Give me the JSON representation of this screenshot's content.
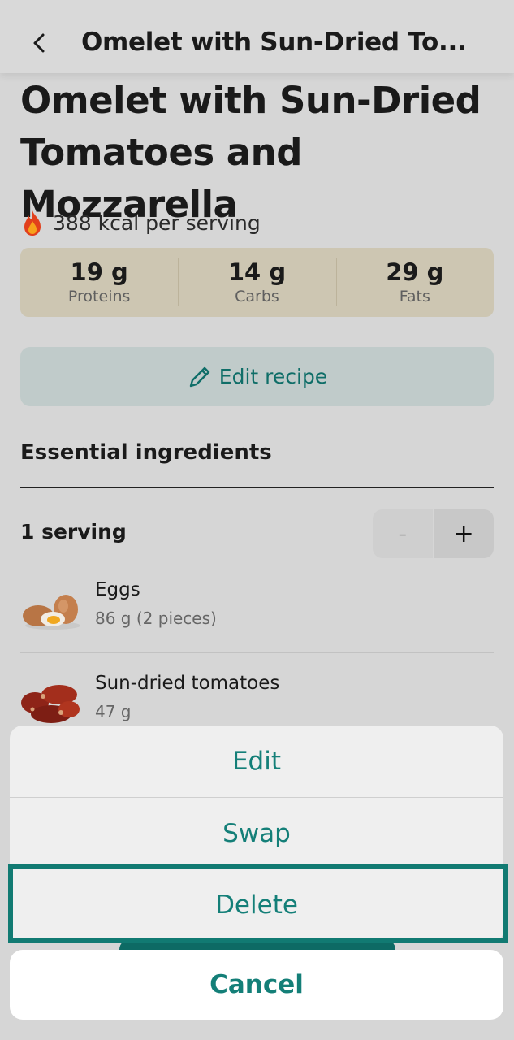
{
  "header": {
    "title": "Omelet with Sun-Dried To..."
  },
  "recipe": {
    "title": "Omelet with Sun-Dried Tomatoes and Mozzarella",
    "kcal": "388 kcal per serving",
    "macros": [
      {
        "value": "19 g",
        "label": "Proteins"
      },
      {
        "value": "14 g",
        "label": "Carbs"
      },
      {
        "value": "29 g",
        "label": "Fats"
      }
    ],
    "edit_label": "Edit recipe"
  },
  "ingredients": {
    "section_title": "Essential ingredients",
    "serving_label": "1 serving",
    "minus": "-",
    "plus": "+",
    "items": [
      {
        "name": "Eggs",
        "amount": "86 g (2 pieces)"
      },
      {
        "name": "Sun-dried tomatoes",
        "amount": "47 g"
      }
    ]
  },
  "action_sheet": {
    "edit": "Edit",
    "swap": "Swap",
    "delete": "Delete",
    "cancel": "Cancel"
  },
  "colors": {
    "accent": "#147f78",
    "macro_bg": "#cdc6b2",
    "highlight": "#117a72"
  }
}
